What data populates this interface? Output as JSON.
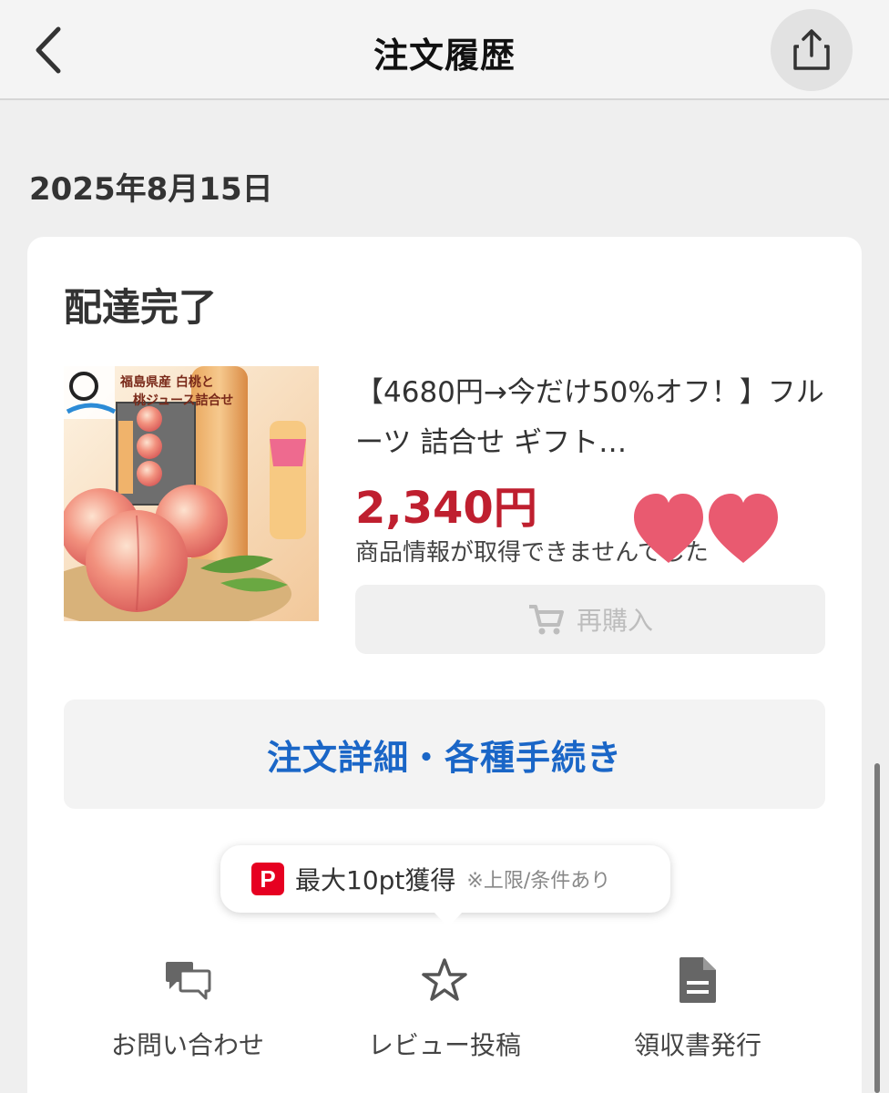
{
  "header": {
    "title": "注文履歴",
    "back_icon": "chevron-left-icon",
    "share_icon": "share-icon"
  },
  "order": {
    "date": "2025年8月15日",
    "status": "配達完了",
    "product": {
      "image_caption_line1": "福島県産 白桃と",
      "image_caption_line2": "桃ジュース詰合せ",
      "name": "【4680円→今だけ50%オフ！】フルーツ 詰合せ ギフト…",
      "price": "2,340円",
      "info": "商品情報が取得できませんでした"
    },
    "rebuy_label": "再購入",
    "detail_label": "注文詳細・各種手続き"
  },
  "points": {
    "logo": "P",
    "main": "最大10pt獲得",
    "note": "※上限/条件あり"
  },
  "actions": [
    {
      "label": "お問い合わせ",
      "icon": "chat-bubbles-icon"
    },
    {
      "label": "レビュー投稿",
      "icon": "star-icon"
    },
    {
      "label": "領収書発行",
      "icon": "document-icon"
    }
  ],
  "colors": {
    "price": "#bf1f2f",
    "link": "#1a66c7",
    "heart": "#e95a70",
    "paypay": "#e60021"
  }
}
